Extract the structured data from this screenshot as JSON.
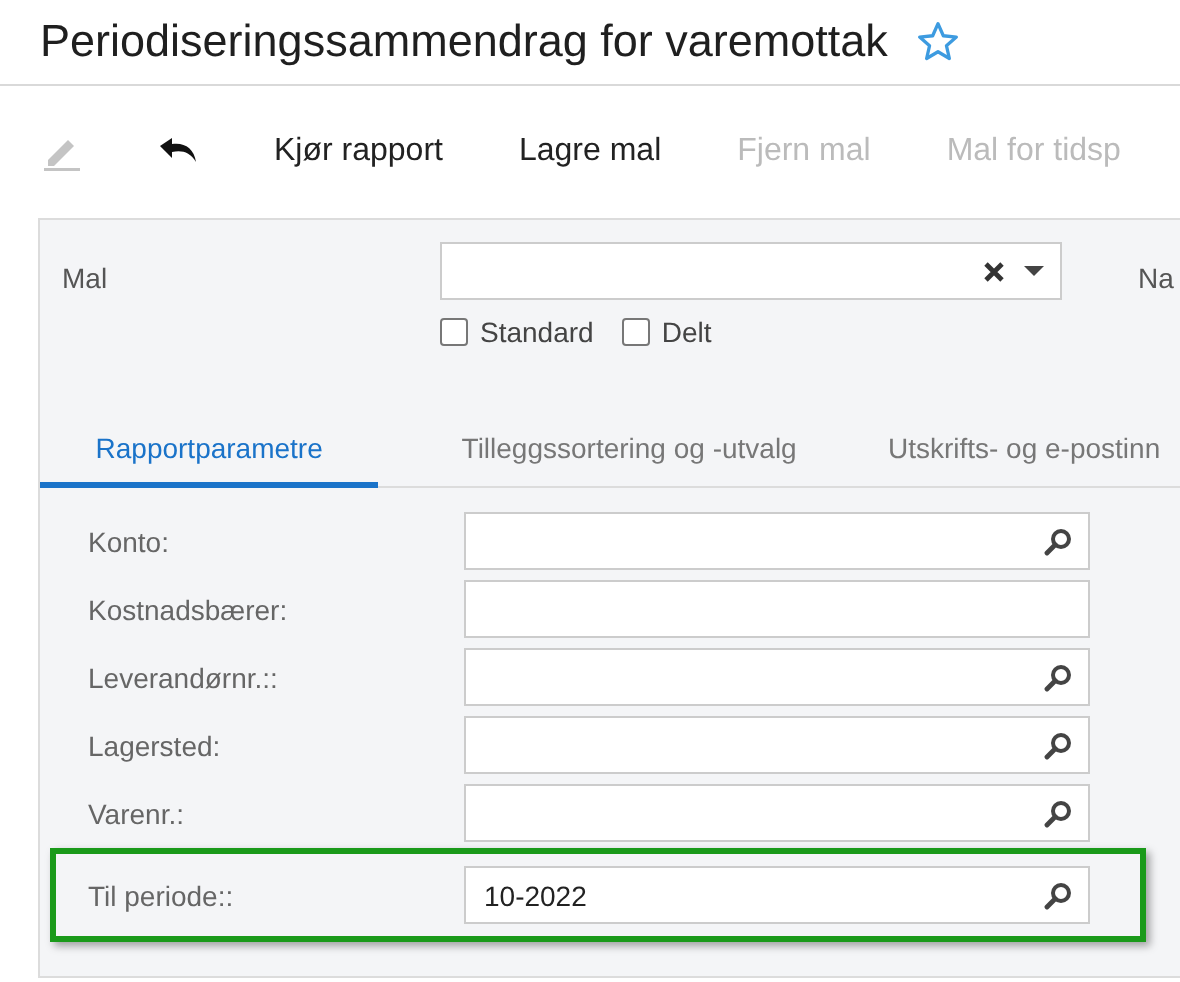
{
  "window": {
    "title": "Periodiseringssammendrag for varemottak",
    "favorite": false
  },
  "toolbar": [
    {
      "kind": "edit-icon",
      "disabled": true
    },
    {
      "kind": "undo-icon",
      "disabled": false
    },
    {
      "kind": "text",
      "label": "Kjør rapport",
      "disabled": false
    },
    {
      "kind": "text",
      "label": "Lagre mal",
      "disabled": false
    },
    {
      "kind": "text",
      "label": "Fjern mal",
      "disabled": true
    },
    {
      "kind": "text",
      "label": "Mal for tidsp",
      "disabled": true
    }
  ],
  "template": {
    "label": "Mal",
    "next_label": "Na",
    "checkboxes": [
      {
        "label": "Standard",
        "checked": false
      },
      {
        "label": "Delt",
        "checked": false
      }
    ]
  },
  "tabs": [
    {
      "label": "Rapportparametre",
      "selected": true
    },
    {
      "label": "Tilleggssortering og -utvalg",
      "selected": false
    },
    {
      "label": "Utskrifts- og e-postinn",
      "selected": false
    }
  ],
  "fields": [
    {
      "label": "Konto:",
      "kind": "lookup",
      "highlighted": false
    },
    {
      "label": "Kostnadsbærer:",
      "kind": "text",
      "highlighted": false
    },
    {
      "label": "Leverandørnr.::",
      "kind": "lookup",
      "highlighted": false
    },
    {
      "label": "Lagersted:",
      "kind": "lookup",
      "highlighted": false
    },
    {
      "label": "Varenr.:",
      "kind": "lookup",
      "highlighted": false
    },
    {
      "label": "Til periode::",
      "kind": "lookup",
      "value": "10-2022",
      "highlighted": true
    }
  ]
}
